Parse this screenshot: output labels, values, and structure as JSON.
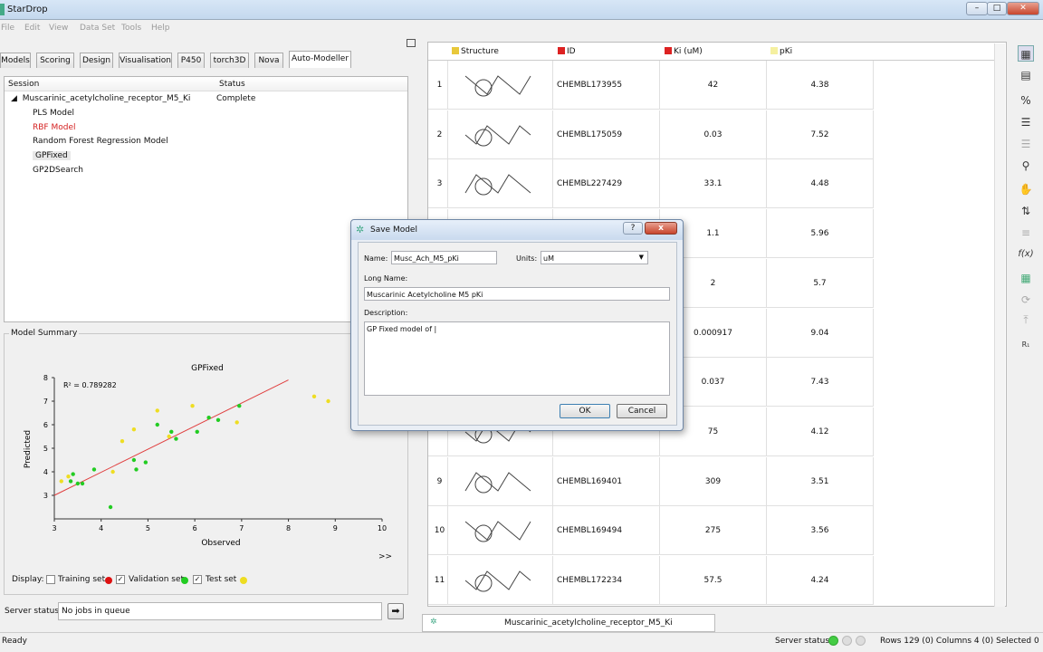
{
  "window": {
    "title": "StarDrop"
  },
  "menu": [
    "File",
    "Edit",
    "View",
    "Data Set",
    "Tools",
    "Help"
  ],
  "tabs": [
    {
      "label": "Models"
    },
    {
      "label": "Scoring"
    },
    {
      "label": "Design"
    },
    {
      "label": "Visualisation"
    },
    {
      "label": "P450"
    },
    {
      "label": "torch3D"
    },
    {
      "label": "Nova"
    },
    {
      "label": "Auto-Modeller"
    }
  ],
  "session_panel": {
    "col_session": "Session",
    "col_status": "Status",
    "session_name": "Muscarinic_acetylcholine_receptor_M5_Ki",
    "session_status": "Complete",
    "models": [
      "PLS Model",
      "RBF Model",
      "Random Forest Regression Model",
      "GPFixed",
      "GP2DSearch"
    ]
  },
  "model_summary": {
    "label": "Model Summary",
    "more": ">>",
    "display_label": "Display:",
    "training_label": "Training set",
    "validation_label": "Validation set",
    "test_label": "Test set",
    "training_checked": false,
    "validation_checked": true,
    "test_checked": true,
    "colors": {
      "training": "#dd1111",
      "validation": "#22cc22",
      "test": "#eedd22",
      "fit_line": "#e04040"
    }
  },
  "chart_data": {
    "type": "scatter",
    "title": "GPFixed",
    "xlabel": "Observed",
    "ylabel": "Predicted",
    "annotation": "R² = 0.789282",
    "xlim": [
      3,
      10
    ],
    "ylim": [
      2,
      8
    ],
    "xticks": [
      3,
      4,
      5,
      6,
      7,
      8,
      9,
      10
    ],
    "yticks": [
      3,
      4,
      5,
      6,
      7,
      8
    ],
    "fit_line": [
      [
        3,
        3.0
      ],
      [
        8,
        7.9
      ]
    ],
    "grid": false,
    "series": [
      {
        "name": "Validation set",
        "points": [
          [
            3.35,
            3.6
          ],
          [
            3.4,
            3.9
          ],
          [
            3.5,
            3.5
          ],
          [
            3.6,
            3.5
          ],
          [
            3.85,
            4.1
          ],
          [
            4.2,
            2.5
          ],
          [
            4.7,
            4.5
          ],
          [
            4.75,
            4.1
          ],
          [
            4.95,
            4.4
          ],
          [
            5.2,
            6.0
          ],
          [
            5.5,
            5.7
          ],
          [
            5.6,
            5.4
          ],
          [
            6.05,
            5.7
          ],
          [
            6.3,
            6.3
          ],
          [
            6.5,
            6.2
          ],
          [
            6.95,
            6.8
          ]
        ]
      },
      {
        "name": "Test set",
        "points": [
          [
            3.15,
            3.6
          ],
          [
            3.3,
            3.8
          ],
          [
            4.25,
            4.0
          ],
          [
            4.45,
            5.3
          ],
          [
            4.7,
            5.8
          ],
          [
            5.2,
            6.6
          ],
          [
            5.45,
            5.5
          ],
          [
            5.95,
            6.8
          ],
          [
            6.9,
            6.1
          ],
          [
            8.55,
            7.2
          ],
          [
            8.85,
            7.0
          ]
        ]
      }
    ]
  },
  "server": {
    "label": "Server status:",
    "value": "No jobs in queue"
  },
  "grid": {
    "headers": {
      "structure": "Structure",
      "id": "ID",
      "ki": "Ki (uM)",
      "pki": "pKi"
    },
    "header_colors": {
      "structure": "#e8c83a",
      "id": "#dd2222",
      "ki": "#dd2222",
      "pki": "#f5f0a0"
    },
    "rows": [
      {
        "n": "1",
        "id": "CHEMBL173955",
        "ki": "42",
        "pki": "4.38"
      },
      {
        "n": "2",
        "id": "CHEMBL175059",
        "ki": "0.03",
        "pki": "7.52"
      },
      {
        "n": "3",
        "id": "CHEMBL227429",
        "ki": "33.1",
        "pki": "4.48"
      },
      {
        "n": "",
        "id": "",
        "ki": "1.1",
        "pki": "5.96"
      },
      {
        "n": "",
        "id": "",
        "ki": "2",
        "pki": "5.7"
      },
      {
        "n": "",
        "id": "",
        "ki": "0.000917",
        "pki": "9.04"
      },
      {
        "n": "",
        "id": "",
        "ki": "0.037",
        "pki": "7.43"
      },
      {
        "n": "",
        "id": "",
        "ki": "75",
        "pki": "4.12"
      },
      {
        "n": "9",
        "id": "CHEMBL169401",
        "ki": "309",
        "pki": "3.51"
      },
      {
        "n": "10",
        "id": "CHEMBL169494",
        "ki": "275",
        "pki": "3.56"
      },
      {
        "n": "11",
        "id": "CHEMBL172234",
        "ki": "57.5",
        "pki": "4.24"
      }
    ]
  },
  "bottom_tab": {
    "label": "Muscarinic_acetylcholine_receptor_M5_Ki"
  },
  "status_bar": {
    "left": "Ready",
    "server_label": "Server status:",
    "rows_info": "Rows 129 (0) Columns 4 (0) Selected 0"
  },
  "dialog": {
    "title": "Save Model",
    "help": "?",
    "close": "x",
    "name_label": "Name:",
    "name_value": "Musc_Ach_M5_pKi",
    "units_label": "Units:",
    "units_value": "uM",
    "long_name_label": "Long Name:",
    "long_name_value": "Muscarinic Acetylcholine M5 pKi",
    "description_label": "Description:",
    "description_value": "GP Fixed model of |",
    "ok": "OK",
    "cancel": "Cancel"
  }
}
